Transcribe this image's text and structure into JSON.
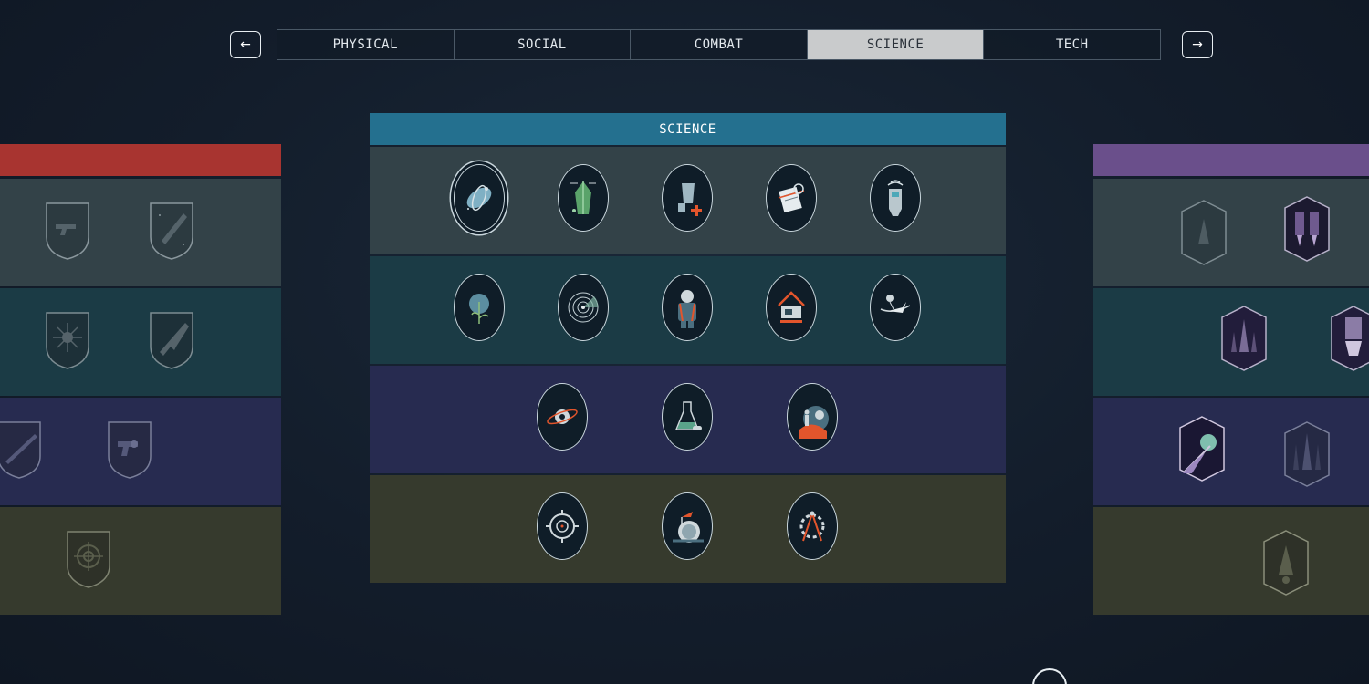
{
  "nav": {
    "prev_icon": "←",
    "next_icon": "→",
    "tabs": [
      {
        "label": "PHYSICAL",
        "active": false
      },
      {
        "label": "SOCIAL",
        "active": false
      },
      {
        "label": "COMBAT",
        "active": false
      },
      {
        "label": "SCIENCE",
        "active": true
      },
      {
        "label": "TECH",
        "active": false
      }
    ]
  },
  "science": {
    "title": "SCIENCE",
    "header_color": "#24708f",
    "rows": [
      [
        "astrodynamics-icon",
        "geology-icon",
        "medicine-icon",
        "research-methods-icon",
        "scanning-icon"
      ],
      [
        "botany-icon",
        "planetary-survey-icon",
        "spacesuit-design-icon",
        "outpost-engineering-icon",
        "zoology-icon"
      ],
      [
        "astrophysics-icon",
        "chemistry-icon",
        "aneutronic-fusion-icon"
      ],
      [
        "sensors-icon",
        "planetary-habitation-icon",
        "special-projects-icon"
      ]
    ]
  },
  "combat": {
    "header_color": "#a83430",
    "rows": [
      [
        "pistol-icon",
        "shotgun-icon"
      ],
      [
        "dueling-icon",
        "rifle-icon"
      ],
      [
        "sniper-icon",
        "heavy-weapons-icon"
      ],
      [
        "targeting-icon"
      ]
    ]
  },
  "tech": {
    "header_color": "#6a4f8b",
    "rows": [
      [
        "ballistics-icon",
        "boost-pack-icon"
      ],
      [
        "piloting-icon",
        "payloads-icon"
      ],
      [
        "starship-engineering-icon",
        "starship-design-icon"
      ],
      [
        "shield-systems-icon"
      ]
    ]
  }
}
